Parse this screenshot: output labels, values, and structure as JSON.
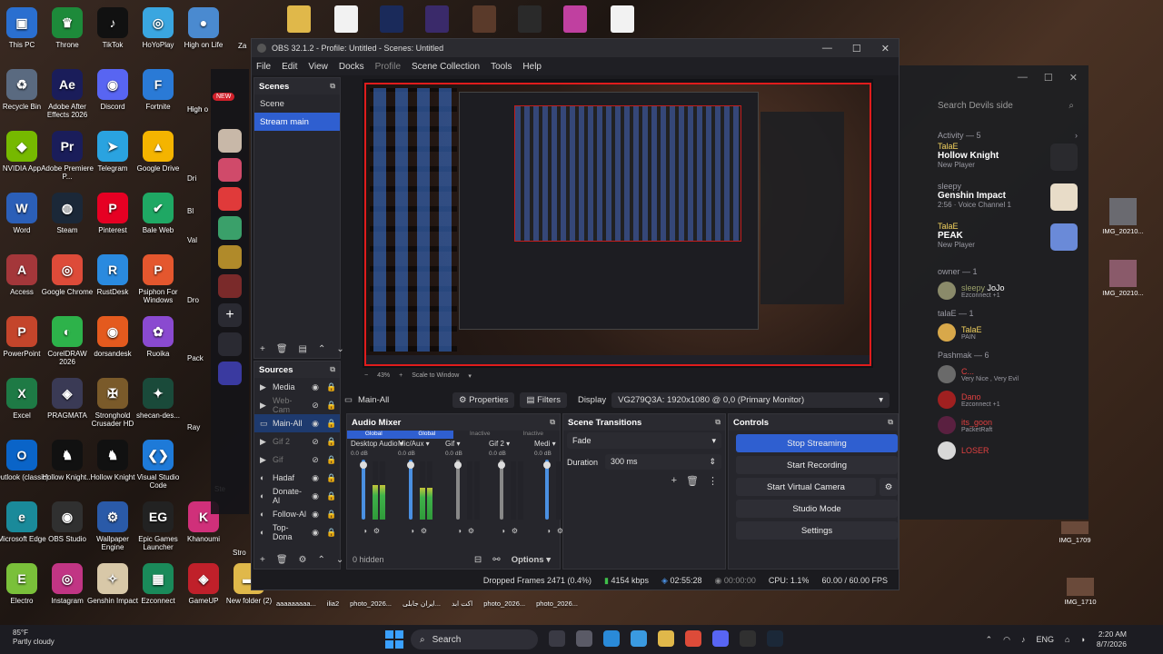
{
  "desktop": {
    "icons": [
      {
        "label": "This PC",
        "color": "#2a6fd0",
        "glyph": "▣"
      },
      {
        "label": "Throne",
        "color": "#1d8a3a",
        "glyph": "♛"
      },
      {
        "label": "TikTok",
        "color": "#111111",
        "glyph": "♪"
      },
      {
        "label": "HoYoPlay",
        "color": "#3aa6e0",
        "glyph": "◎"
      },
      {
        "label": "High on Life",
        "color": "#4a8ad0",
        "glyph": "●"
      },
      {
        "label": "Recycle Bin",
        "color": "#5a6a80",
        "glyph": "♻"
      },
      {
        "label": "Adobe After Effects 2026",
        "color": "#1a1d5a",
        "glyph": "Ae"
      },
      {
        "label": "Discord",
        "color": "#5865f2",
        "glyph": "◉"
      },
      {
        "label": "Fortnite",
        "color": "#2a7ad6",
        "glyph": "F"
      },
      {
        "label": "NVIDIA App",
        "color": "#76b900",
        "glyph": "◆"
      },
      {
        "label": "Adobe Premiere P...",
        "color": "#1a1d5a",
        "glyph": "Pr"
      },
      {
        "label": "Telegram",
        "color": "#2aa3e0",
        "glyph": "➤"
      },
      {
        "label": "Google Drive",
        "color": "#f4b400",
        "glyph": "▲"
      },
      {
        "label": "Word",
        "color": "#2b5fb8",
        "glyph": "W"
      },
      {
        "label": "Steam",
        "color": "#1b2838",
        "glyph": "◍"
      },
      {
        "label": "Pinterest",
        "color": "#e60023",
        "glyph": "P"
      },
      {
        "label": "Bale Web",
        "color": "#1fa864",
        "glyph": "✔"
      },
      {
        "label": "Access",
        "color": "#a4373a",
        "glyph": "A"
      },
      {
        "label": "Google Chrome",
        "color": "#dd4b39",
        "glyph": "◎"
      },
      {
        "label": "RustDesk",
        "color": "#2a8adf",
        "glyph": "R"
      },
      {
        "label": "Psiphon For Windows",
        "color": "#e4572e",
        "glyph": "P"
      },
      {
        "label": "PowerPoint",
        "color": "#c4452b",
        "glyph": "P"
      },
      {
        "label": "CorelDRAW 2026",
        "color": "#2db24a",
        "glyph": "◐"
      },
      {
        "label": "dorsandesk",
        "color": "#e45a1e",
        "glyph": "◉"
      },
      {
        "label": "Ruoika",
        "color": "#8a4ad0",
        "glyph": "✿"
      },
      {
        "label": "Excel",
        "color": "#1e7a45",
        "glyph": "X"
      },
      {
        "label": "PRAGMATA",
        "color": "#3a3a55",
        "glyph": "◈"
      },
      {
        "label": "Stronghold Crusader HD",
        "color": "#7a5a2a",
        "glyph": "✠"
      },
      {
        "label": "shecan-des...",
        "color": "#1a4a3a",
        "glyph": "✦"
      },
      {
        "label": "Outlook (classic)",
        "color": "#0a64c8",
        "glyph": "O"
      },
      {
        "label": "Hollow Knight...",
        "color": "#111111",
        "glyph": "♞"
      },
      {
        "label": "Hollow Knight",
        "color": "#111111",
        "glyph": "♞"
      },
      {
        "label": "Visual Studio Code",
        "color": "#1e7ad8",
        "glyph": "❮❯"
      },
      {
        "label": "Microsoft Edge",
        "color": "#1a8a9a",
        "glyph": "e"
      },
      {
        "label": "OBS Studio",
        "color": "#303030",
        "glyph": "◉"
      },
      {
        "label": "Wallpaper Engine",
        "color": "#2a5aa8",
        "glyph": "⚙"
      },
      {
        "label": "Epic Games Launcher",
        "color": "#222222",
        "glyph": "EG"
      },
      {
        "label": "Khanoumi",
        "color": "#d0307a",
        "glyph": "K"
      },
      {
        "label": "Electro",
        "color": "#7ac03a",
        "glyph": "E"
      },
      {
        "label": "Instagram",
        "color": "#c13584",
        "glyph": "◎"
      },
      {
        "label": "Genshin Impact",
        "color": "#d8c8a8",
        "glyph": "✧"
      },
      {
        "label": "Ezconnect",
        "color": "#1a8a5a",
        "glyph": "▦"
      },
      {
        "label": "GameUP",
        "color": "#c0202a",
        "glyph": "◈"
      },
      {
        "label": "New folder (2)",
        "color": "#e0b84a",
        "glyph": "▬"
      }
    ],
    "partial_labels": [
      "Za",
      "High o",
      "Dri",
      "Dro",
      "Pack",
      "Ray",
      "Stro",
      "Ste",
      "High",
      "Bl",
      "Val"
    ],
    "bottom_files": [
      "aaaaaaaaa...",
      "ilia2",
      "photo_2026...",
      "ایران جابلی...",
      "اکت ابد",
      "photo_2026...",
      "photo_2026..."
    ],
    "right_files": [
      "IMG_20210...",
      "IMG_20210...",
      "IMG_1709",
      "IMG_1710"
    ],
    "badge_new": "NEW"
  },
  "discord": {
    "search_placeholder": "Search Devils side",
    "activity_header": "Activity — 5",
    "activities": [
      {
        "user": "TalaE",
        "game": "Hollow Knight",
        "status": "New Player"
      },
      {
        "user": "sleepy",
        "game": "Genshin Impact",
        "status": "2:56 · Voice Channel 1"
      },
      {
        "user": "TalaE",
        "game": "PEAK",
        "status": "New Player"
      }
    ],
    "groups": [
      {
        "title": "owner — 1",
        "members": [
          {
            "name": "sleepy",
            "extra": "JoJo",
            "sub": "Ezconnect +1",
            "color": "#9aa06a"
          }
        ]
      },
      {
        "title": "talaE — 1",
        "members": [
          {
            "name": "TalaE",
            "sub": "PAIN",
            "color": "#f4d35e"
          }
        ]
      },
      {
        "title": "Pashmak — 6",
        "members": [
          {
            "name": "C...",
            "sub": "Very Nice , Very Evil",
            "color": "#e04040"
          },
          {
            "name": "Dano",
            "sub": "Ezconnect +1",
            "color": "#e04040"
          },
          {
            "name": "its_goon",
            "sub": "PacketRaft",
            "color": "#e04040"
          },
          {
            "name": "LOSER",
            "sub": "",
            "color": "#e04040"
          }
        ]
      }
    ]
  },
  "obs": {
    "title": "OBS 32.1.2 - Profile: Untitled - Scenes: Untitled",
    "menu": [
      "File",
      "Edit",
      "View",
      "Docks",
      "Profile",
      "Scene Collection",
      "Tools",
      "Help"
    ],
    "scenes_title": "Scenes",
    "scenes": [
      "Scene",
      "Stream main"
    ],
    "selected_scene": "Stream main",
    "sources_title": "Sources",
    "sources": [
      {
        "name": "Media",
        "icon": "▶",
        "dim": false
      },
      {
        "name": "Web-Cam",
        "icon": "▶",
        "dim": true
      },
      {
        "name": "Main-All",
        "icon": "▭",
        "dim": false,
        "sel": true
      },
      {
        "name": "Gif 2",
        "icon": "▶",
        "dim": true
      },
      {
        "name": "Gif",
        "icon": "▶",
        "dim": true
      },
      {
        "name": "Hadaf",
        "icon": "◐",
        "dim": false
      },
      {
        "name": "Donate-Al",
        "icon": "◐",
        "dim": false
      },
      {
        "name": "Follow-Al",
        "icon": "◐",
        "dim": false
      },
      {
        "name": "Top-Dona",
        "icon": "◐",
        "dim": false
      }
    ],
    "zoom_label": "43%",
    "scale_label": "Scale to Window",
    "source_bar": {
      "current": "Main-All",
      "properties": "Properties",
      "filters": "Filters",
      "display_label": "Display",
      "display_value": "VG279Q3A: 1920x1080 @ 0,0 (Primary Monitor)"
    },
    "mixer": {
      "title": "Audio Mixer",
      "tabs": [
        "Global",
        "Global",
        "Inactive",
        "Inactive"
      ],
      "channels": [
        {
          "name": "Desktop Audio",
          "level": 0.6,
          "active": true
        },
        {
          "name": "Mic/Aux",
          "level": 0.55,
          "active": true
        },
        {
          "name": "Gif",
          "level": 0.0,
          "active": false
        },
        {
          "name": "Gif 2",
          "level": 0.0,
          "active": false
        },
        {
          "name": "Medi",
          "level": 0.0,
          "active": true
        }
      ],
      "db_label": "0.0 dB",
      "hidden_label": "0 hidden",
      "options_label": "Options"
    },
    "transitions": {
      "title": "Scene Transitions",
      "type": "Fade",
      "duration_label": "Duration",
      "duration_value": "300 ms"
    },
    "controls": {
      "title": "Controls",
      "buttons": [
        "Stop Streaming",
        "Start Recording",
        "Start Virtual Camera",
        "Studio Mode",
        "Settings"
      ]
    },
    "status": {
      "dropped": "Dropped Frames 2471 (0.4%)",
      "bitrate": "4154 kbps",
      "stream_time": "02:55:28",
      "rec_time": "00:00:00",
      "cpu": "CPU: 1.1%",
      "fps": "60.00 / 60.00 FPS"
    }
  },
  "taskbar": {
    "temp": "85°F",
    "weather": "Partly cloudy",
    "search": "Search",
    "lang": "ENG",
    "time": "2:20 AM",
    "date": "8/7/2026"
  }
}
